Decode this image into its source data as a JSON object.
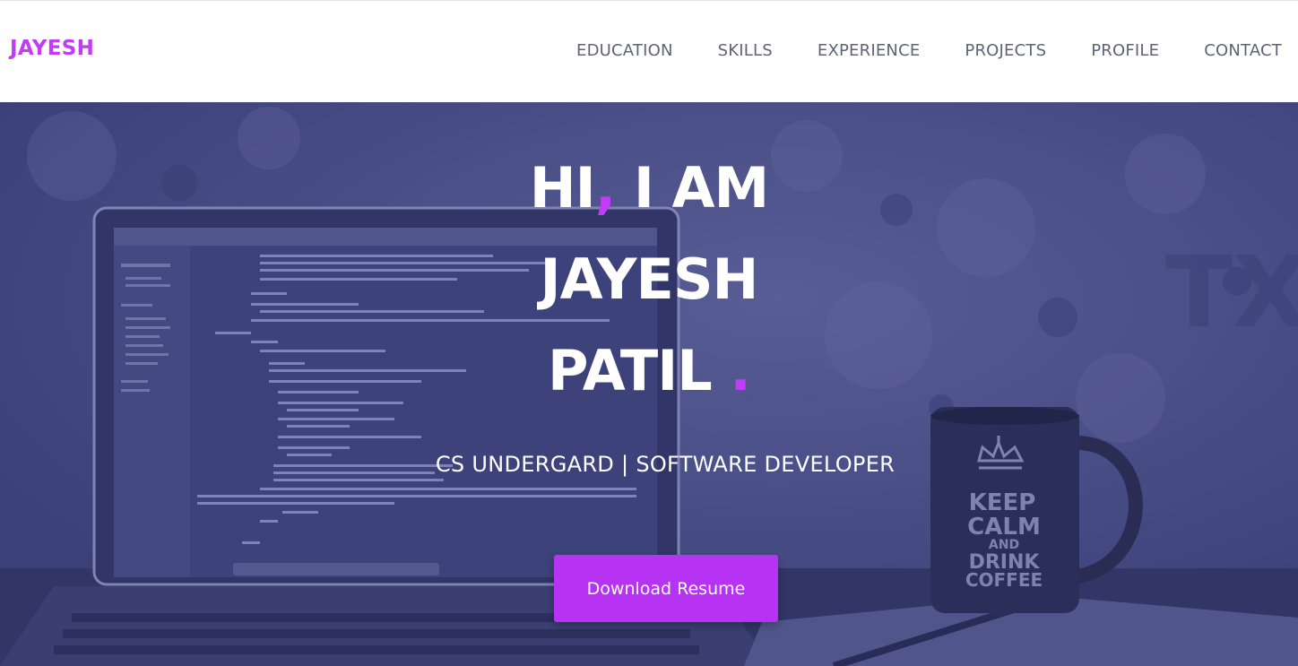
{
  "nav": {
    "brand": "JAYESH",
    "links": [
      "EDUCATION",
      "SKILLS",
      "EXPERIENCE",
      "PROJECTS",
      "PROFILE",
      "CONTACT"
    ]
  },
  "hero": {
    "greeting_part1": "HI",
    "greeting_comma": ",",
    "greeting_part2": " I AM",
    "first_name": "JAYESH",
    "last_name": "PATIL",
    "period": ".",
    "subtitle": "CS UNDERGARD | SOFTWARE DEVELOPER",
    "resume_button": "Download Resume",
    "mug_text": [
      "KEEP",
      "CALM",
      "AND",
      "DRINK",
      "COFFEE"
    ]
  },
  "colors": {
    "accent": "#c23bf5",
    "button": "#b633f3",
    "overlay": "#4b4f86",
    "nav_text": "#5f6377"
  }
}
